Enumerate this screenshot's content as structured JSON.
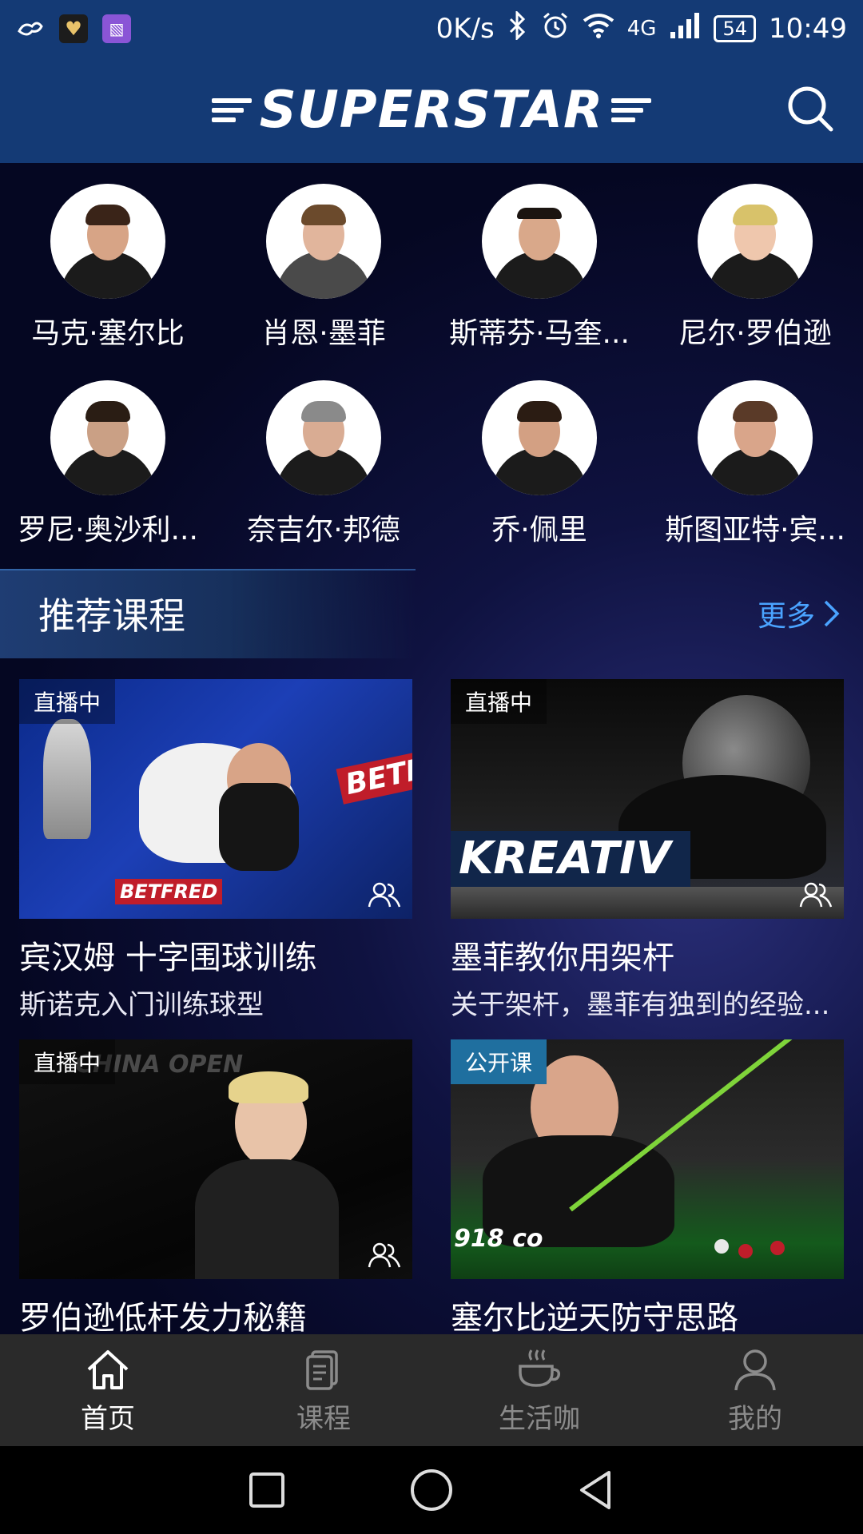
{
  "status_bar": {
    "speed": "0K/s",
    "network": "4G",
    "battery": "54",
    "time": "10:49"
  },
  "header": {
    "logo": "SUPERSTAR"
  },
  "players": [
    {
      "name": "马克·塞尔比",
      "hair": "#3a2418",
      "head": "#d7a486"
    },
    {
      "name": "肖恩·墨菲",
      "hair": "#6b4a2c",
      "head": "#e1b59c"
    },
    {
      "name": "斯蒂芬·马奎...",
      "hair": "#1b1410",
      "head": "#d9a88a"
    },
    {
      "name": "尼尔·罗伯逊",
      "hair": "#d8c26a",
      "head": "#efc7ad"
    },
    {
      "name": "罗尼·奥沙利...",
      "hair": "#2a1d14",
      "head": "#caa085"
    },
    {
      "name": "奈吉尔·邦德",
      "hair": "#8a8a8a",
      "head": "#d9ac93"
    },
    {
      "name": "乔·佩里",
      "hair": "#2b1c13",
      "head": "#d3a083"
    },
    {
      "name": "斯图亚特·宾...",
      "hair": "#5a3a28",
      "head": "#d9a58a"
    }
  ],
  "section": {
    "title": "推荐课程",
    "more": "更多"
  },
  "courses": [
    {
      "badge": "直播中",
      "title": "宾汉姆 十字围球训练",
      "subtitle": "斯诺克入门训练球型"
    },
    {
      "badge": "直播中",
      "title": "墨菲教你用架杆",
      "subtitle": "关于架杆，墨菲有独到的经验..."
    },
    {
      "badge": "直播中",
      "title": "罗伯逊低杆发力秘籍",
      "subtitle": ""
    },
    {
      "badge": "公开课",
      "title": "塞尔比逆天防守思路",
      "subtitle": ""
    }
  ],
  "thumb_text": {
    "c1_brand": "BETFRED",
    "c1_banner": "BETF",
    "c2_banner": "KREATIV",
    "c3_banner": "CHINA OPEN",
    "c4_banner": "918 co"
  },
  "bottom_nav": [
    {
      "label": "首页",
      "icon": "home-icon"
    },
    {
      "label": "课程",
      "icon": "document-icon"
    },
    {
      "label": "生活咖",
      "icon": "coffee-icon"
    },
    {
      "label": "我的",
      "icon": "user-icon"
    }
  ],
  "colors": {
    "header_bg": "#143a75",
    "accent_more": "#4aa3ff",
    "nav_bg": "#2a2a2a",
    "nav_inactive": "#8b8b8b"
  }
}
